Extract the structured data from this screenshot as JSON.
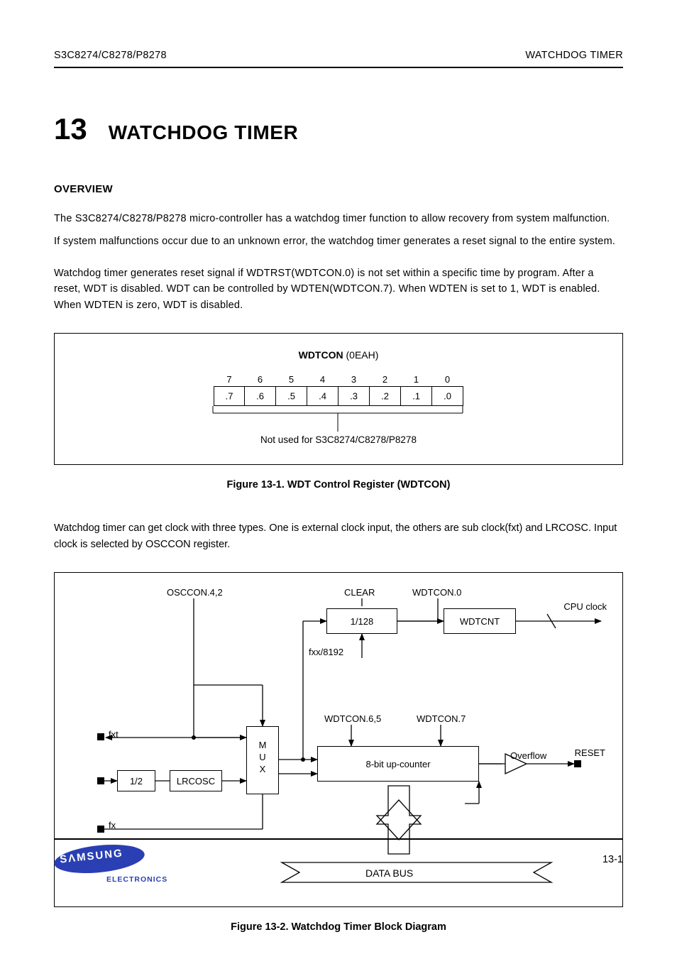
{
  "header": {
    "left": "S3C8274/C8278/P8278",
    "right": "WATCHDOG TIMER"
  },
  "section": {
    "number": "13",
    "title_prefix": "",
    "title": "WATCHDOG TIMER",
    "heading": "OVERVIEW",
    "p1": "The S3C8274/C8278/P8278 micro-controller has a watchdog timer function to allow recovery from system malfunction.",
    "p2": "If system malfunctions occur due to an unknown error, the watchdog timer generates a reset signal to the entire system.",
    "p3": "Watchdog timer generates reset signal if WDTRST(WDTCON.0) is not set within a specific time by program. After a reset, WDT is disabled. WDT can be controlled by WDTEN(WDTCON.7). When WDTEN is set to 1, WDT is enabled. When WDTEN is zero, WDT is disabled."
  },
  "figure1": {
    "reg_name": "WDTCON",
    "addr": "(0EAH)",
    "bits": [
      "7",
      "6",
      "5",
      "4",
      "3",
      "2",
      "1",
      "0"
    ],
    "names": [
      ".7",
      ".6",
      ".5",
      ".4",
      ".3",
      ".2",
      ".1",
      ".0"
    ],
    "group_label": "Not used for S3C8274/C8278/P8278",
    "caption": "Figure 13-1. WDT Control Register (WDTCON)"
  },
  "between_para": "Watchdog timer can get clock with three types. One is external clock input, the others are sub clock(fxt) and LRCOSC. Input clock is selected by OSCCON register.",
  "figure2": {
    "labels": {
      "oscon42": "OSCCON.4,2",
      "clear": "CLEAR",
      "wdtcon0": "WDTCON.0",
      "wdtcon65": "WDTCON.6,5",
      "wdtcon7": "WDTCON.7",
      "box_1_128": "1/128",
      "box_wdtcnt": "WDTCNT",
      "box_mux": "M\nU\nX",
      "box_8bit": "8-bit up-counter",
      "box_div2": "1/2",
      "box_lrc": "LRCOSC",
      "overflow": "Overflow",
      "fxx8192": "fxx/8192",
      "fxt": "fxt",
      "fx": "fx",
      "cpu_clock": "CPU clock",
      "reset": "RESET",
      "databus": "DATA BUS"
    },
    "caption": "Figure 13-2. Watchdog Timer Block Diagram"
  },
  "logo": {
    "brand": "SΛMSUNG",
    "sub": "ELECTRONICS"
  },
  "page_number": "13-1"
}
